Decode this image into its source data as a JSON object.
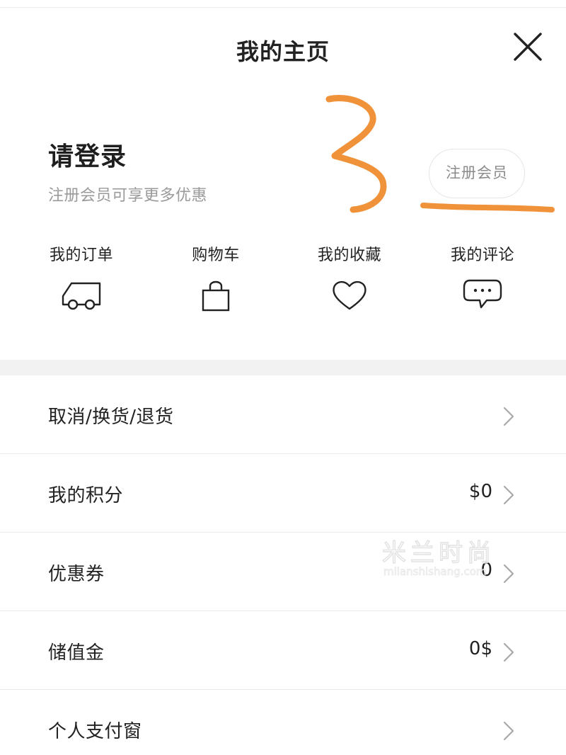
{
  "header": {
    "title": "我的主页"
  },
  "login": {
    "title": "请登录",
    "subtitle": "注册会员可享更多优惠",
    "register_label": "注册会员"
  },
  "quick_links": [
    {
      "label": "我的订单",
      "icon": "truck-icon"
    },
    {
      "label": "购物车",
      "icon": "bag-icon"
    },
    {
      "label": "我的收藏",
      "icon": "heart-icon"
    },
    {
      "label": "我的评论",
      "icon": "comment-icon"
    }
  ],
  "menu": [
    {
      "label": "取消/换货/退货",
      "value": ""
    },
    {
      "label": "我的积分",
      "value": "$0"
    },
    {
      "label": "优惠券",
      "value": "0"
    },
    {
      "label": "储值金",
      "value": "0$"
    },
    {
      "label": "个人支付窗",
      "value": ""
    }
  ],
  "annotation": {
    "mark": "3",
    "color": "#f0923a"
  },
  "watermark": {
    "text": "米兰时尚",
    "sub": "milanshishang.com"
  },
  "colors": {
    "text": "#222222",
    "muted": "#9a9a9a",
    "divider": "#ebebeb",
    "section_bg": "#f2f2f2"
  }
}
